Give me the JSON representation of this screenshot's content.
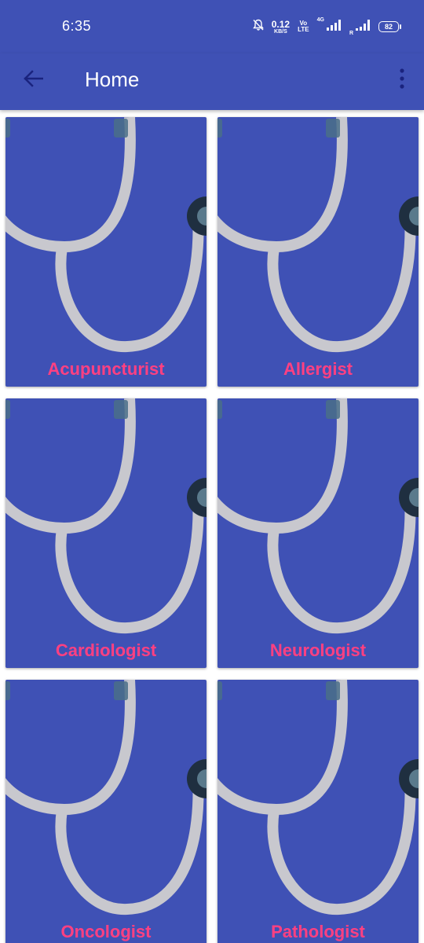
{
  "status_bar": {
    "time": "6:35",
    "net_speed_value": "0.12",
    "net_speed_unit": "KB/S",
    "volte_top": "Vo",
    "volte_bottom": "LTE",
    "network_type": "4G",
    "roaming": "R",
    "battery": "82",
    "icons": [
      "bell-muted-icon",
      "signal-icon",
      "battery-icon"
    ]
  },
  "app_bar": {
    "title": "Home",
    "back_icon": "arrow-left-icon",
    "menu_icon": "more-vertical-icon"
  },
  "specialties": [
    {
      "label": "Acupuncturist"
    },
    {
      "label": "Allergist"
    },
    {
      "label": "Cardiologist"
    },
    {
      "label": "Neurologist"
    },
    {
      "label": "Oncologist"
    },
    {
      "label": "Pathologist"
    }
  ],
  "colors": {
    "primary": "#3f51b5",
    "accent": "#ff4081",
    "stethoscope_tube": "#c8c8ce",
    "chest_piece": "#1f2f40"
  }
}
